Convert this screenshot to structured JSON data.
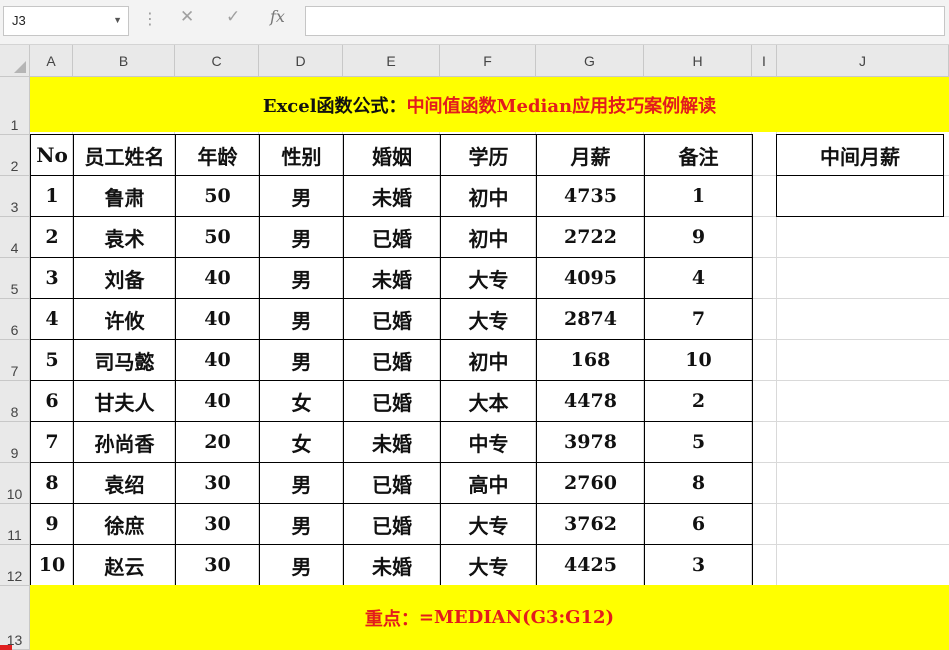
{
  "formula_bar": {
    "name_box": "J3",
    "formula": ""
  },
  "columns": [
    "A",
    "B",
    "C",
    "D",
    "E",
    "F",
    "G",
    "H",
    "I",
    "J"
  ],
  "rows": [
    "1",
    "2",
    "3",
    "4",
    "5",
    "6",
    "7",
    "8",
    "9",
    "10",
    "11",
    "12",
    "13"
  ],
  "title": {
    "prefix": "Excel函数公式：",
    "main": "中间值函数Median应用技巧案例解读"
  },
  "table": {
    "headers": [
      "No",
      "员工姓名",
      "年龄",
      "性别",
      "婚姻",
      "学历",
      "月薪",
      "备注"
    ],
    "rows": [
      [
        "1",
        "鲁肃",
        "50",
        "男",
        "未婚",
        "初中",
        "4735",
        "1"
      ],
      [
        "2",
        "袁术",
        "50",
        "男",
        "已婚",
        "初中",
        "2722",
        "9"
      ],
      [
        "3",
        "刘备",
        "40",
        "男",
        "未婚",
        "大专",
        "4095",
        "4"
      ],
      [
        "4",
        "许攸",
        "40",
        "男",
        "已婚",
        "大专",
        "2874",
        "7"
      ],
      [
        "5",
        "司马懿",
        "40",
        "男",
        "已婚",
        "初中",
        "168",
        "10"
      ],
      [
        "6",
        "甘夫人",
        "40",
        "女",
        "已婚",
        "大本",
        "4478",
        "2"
      ],
      [
        "7",
        "孙尚香",
        "20",
        "女",
        "未婚",
        "中专",
        "3978",
        "5"
      ],
      [
        "8",
        "袁绍",
        "30",
        "男",
        "已婚",
        "高中",
        "2760",
        "8"
      ],
      [
        "9",
        "徐庶",
        "30",
        "男",
        "已婚",
        "大专",
        "3762",
        "6"
      ],
      [
        "10",
        "赵云",
        "30",
        "男",
        "未婚",
        "大专",
        "4425",
        "3"
      ]
    ]
  },
  "side_table": {
    "header": "中间月薪",
    "value": ""
  },
  "footer": {
    "prefix": "重点：",
    "formula": "=MEDIAN(G3:G12)"
  },
  "colors": {
    "banner_background": "#ffff00",
    "accent_text": "#e31c1c"
  }
}
